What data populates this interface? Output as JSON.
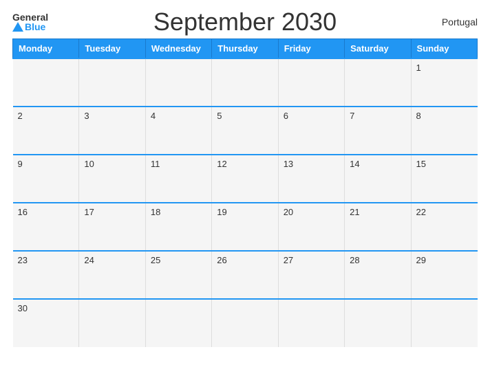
{
  "header": {
    "title": "September 2030",
    "country": "Portugal",
    "logo_general": "General",
    "logo_blue": "Blue"
  },
  "days_of_week": [
    "Monday",
    "Tuesday",
    "Wednesday",
    "Thursday",
    "Friday",
    "Saturday",
    "Sunday"
  ],
  "weeks": [
    [
      null,
      null,
      null,
      null,
      null,
      null,
      1
    ],
    [
      2,
      3,
      4,
      5,
      6,
      7,
      8
    ],
    [
      9,
      10,
      11,
      12,
      13,
      14,
      15
    ],
    [
      16,
      17,
      18,
      19,
      20,
      21,
      22
    ],
    [
      23,
      24,
      25,
      26,
      27,
      28,
      29
    ],
    [
      30,
      null,
      null,
      null,
      null,
      null,
      null
    ]
  ]
}
